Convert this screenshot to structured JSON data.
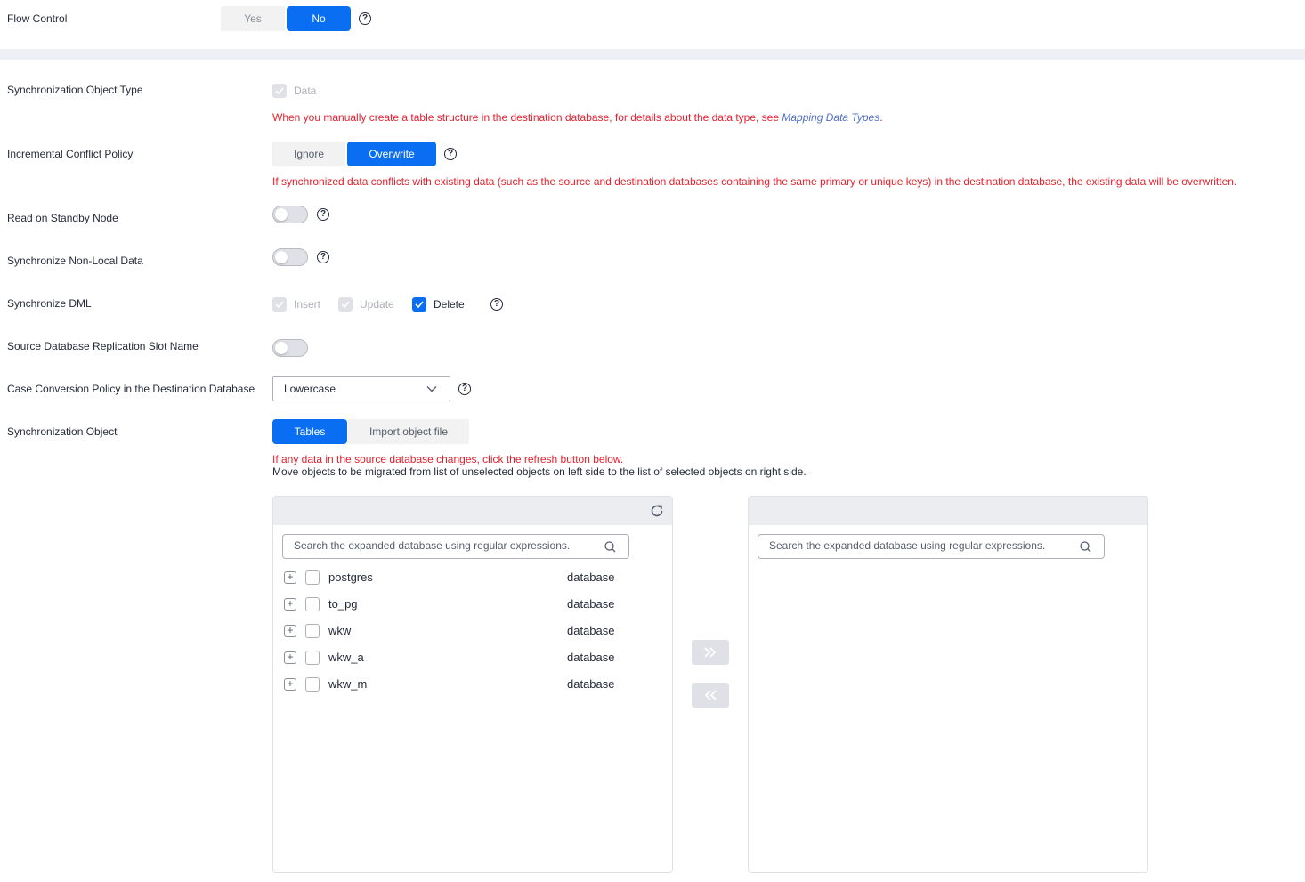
{
  "flow_control": {
    "label": "Flow Control",
    "yes": "Yes",
    "no": "No",
    "selected": "No"
  },
  "sync_object_type": {
    "label": "Synchronization Object Type",
    "checkbox_label": "Data",
    "note_prefix": "When you manually create a table structure in the destination database, for details about the data type, see ",
    "note_link": "Mapping Data Types",
    "note_suffix": "."
  },
  "conflict_policy": {
    "label": "Incremental Conflict Policy",
    "options": [
      "Ignore",
      "Overwrite"
    ],
    "selected": "Overwrite",
    "note": "If synchronized data conflicts with existing data (such as the source and destination databases containing the same primary or unique keys) in the destination database, the existing data will be overwritten."
  },
  "read_standby": {
    "label": "Read on Standby Node",
    "enabled": false
  },
  "sync_nonlocal": {
    "label": "Synchronize Non-Local Data",
    "enabled": false
  },
  "sync_dml": {
    "label": "Synchronize DML",
    "insert": "Insert",
    "update": "Update",
    "delete": "Delete"
  },
  "replication_slot": {
    "label": "Source Database Replication Slot Name",
    "enabled": false
  },
  "case_policy": {
    "label": "Case Conversion Policy in the Destination Database",
    "value": "Lowercase"
  },
  "sync_object": {
    "label": "Synchronization Object",
    "tabs": [
      "Tables",
      "Import object file"
    ],
    "selected": "Tables",
    "warn": "If any data in the source database changes, click the refresh button below.",
    "info": "Move objects to be migrated from list of unselected objects on left side to the list of selected objects on right side."
  },
  "left_panel": {
    "search_placeholder": "Search the expanded database using regular expressions.",
    "rows": [
      {
        "name": "postgres",
        "type": "database"
      },
      {
        "name": "to_pg",
        "type": "database"
      },
      {
        "name": "wkw",
        "type": "database"
      },
      {
        "name": "wkw_a",
        "type": "database"
      },
      {
        "name": "wkw_m",
        "type": "database"
      }
    ]
  },
  "right_panel": {
    "search_placeholder": "Search the expanded database using regular expressions."
  },
  "help_glyph": "?"
}
